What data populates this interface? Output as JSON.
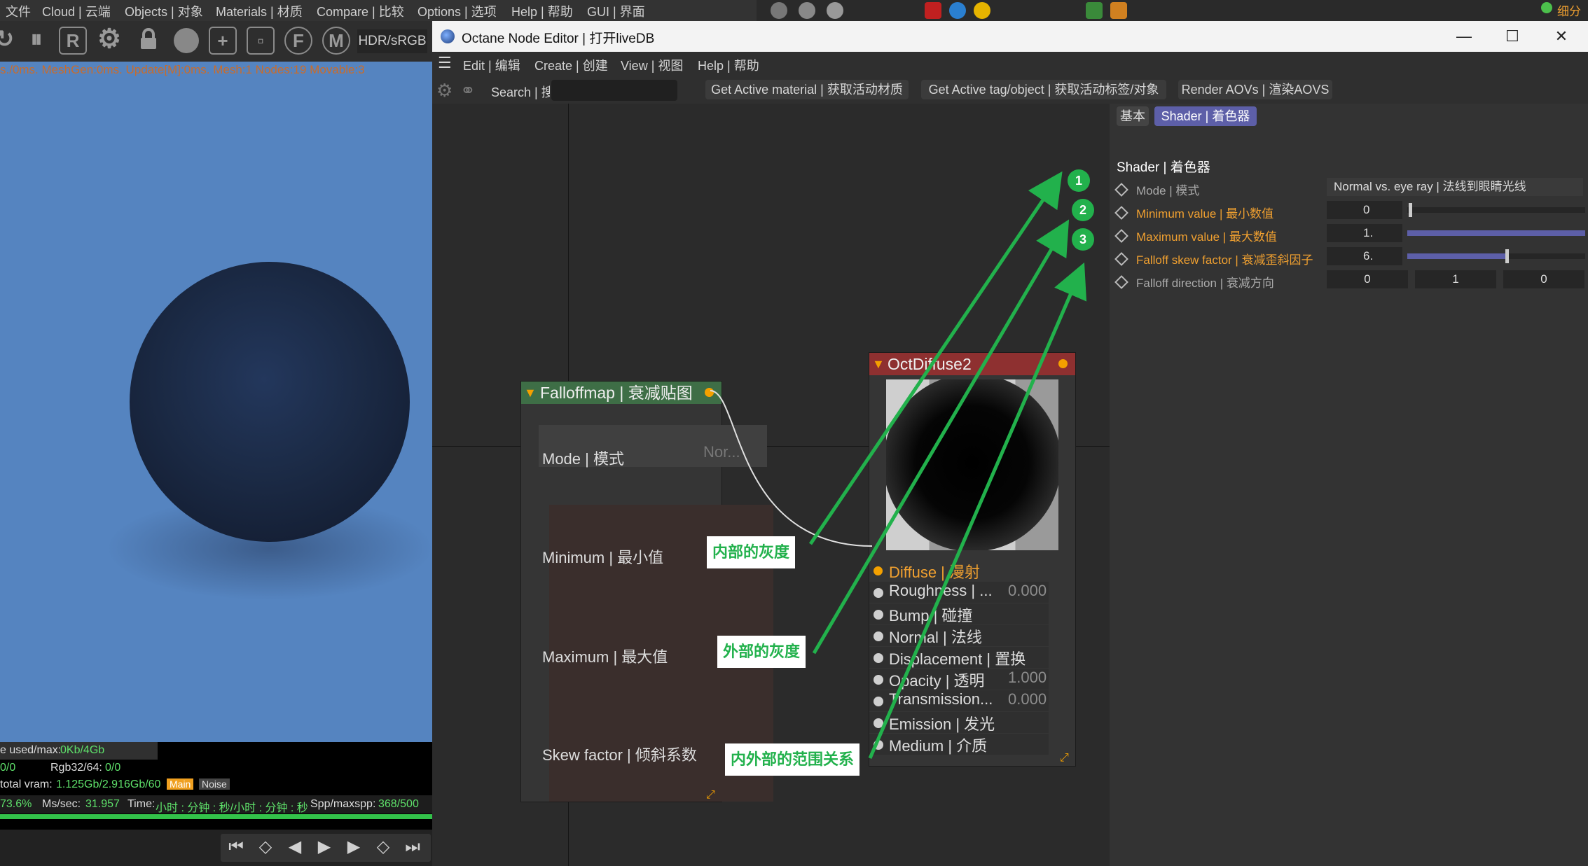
{
  "main_menu": [
    "文件",
    "Cloud | 云端",
    "Objects | 对象",
    "Materials | 材质",
    "Compare | 比较",
    "Options | 选项",
    "Help | 帮助",
    "GUI | 界面"
  ],
  "right_strip": {
    "object_name": "细分曲面"
  },
  "viewport": {
    "hdr_label": "HDR/sRGB",
    "stats": "s./0ms. MeshGen:0ms. Update[M]:0ms. Mesh:1 Nodes:19 Movable:3",
    "toolbar_icons": [
      "refresh-icon",
      "pause-icon",
      "region-render-icon",
      "settings-gear-icon",
      "lock-icon",
      "sphere-icon",
      "add-object-icon",
      "camera-icon",
      "focus-icon",
      "material-icon"
    ]
  },
  "status": {
    "used_max_label": "e used/max:",
    "used_max_value": "0Kb/4Gb",
    "left_value": "0/0",
    "rgb_label": "Rgb32/64:",
    "rgb_value": "0/0",
    "vram_label": "total vram:",
    "vram_value": "1.125Gb/2.916Gb/60",
    "tab_main": "Main",
    "tab_noise": "Noise",
    "percent": "73.6%",
    "ms_label": "Ms/sec:",
    "ms_value": "31.957",
    "time_label": "Time:",
    "time_value": "小时 : 分钟 : 秒/小时 : 分钟 : 秒",
    "spp_label": "Spp/maxspp:",
    "spp_value": "368/500",
    "progress": 0.736
  },
  "playback_buttons": [
    "go-start-icon",
    "prev-key-icon",
    "step-back-icon",
    "play-icon",
    "step-forward-icon",
    "next-key-icon",
    "go-end-icon"
  ],
  "node_window": {
    "title": "Octane Node Editor | 打开liveDB",
    "menu": [
      "Edit | 编辑",
      "Create | 创建",
      "View | 视图",
      "Help | 帮助"
    ],
    "search_label": "Search | 搜",
    "search_value": "",
    "toolbar_buttons": [
      "Get Active material | 获取活动材质",
      "Get Active tag/object | 获取活动标签/对象",
      "Render AOVs | 渲染AOVS"
    ]
  },
  "falloff_node": {
    "title": "Falloffmap | 衰减贴图",
    "mode_label": "Mode | 模式",
    "mode_value": "Nor...",
    "minimum_label": "Minimum | 最小值",
    "maximum_label": "Maximum | 最大值",
    "skew_label": "Skew factor | 倾斜系数"
  },
  "diffuse_node": {
    "title": "OctDiffuse2",
    "inputs": [
      {
        "label": "Diffuse | 漫射",
        "value": "",
        "active": true
      },
      {
        "label": "Roughness | ...",
        "value": "0.000"
      },
      {
        "label": "Bump | 碰撞",
        "value": ""
      },
      {
        "label": "Normal | 法线",
        "value": ""
      },
      {
        "label": "Displacement | 置换",
        "value": ""
      },
      {
        "label": "Opacity | 透明",
        "value": "1.000"
      },
      {
        "label": "Transmission...",
        "value": "0.000"
      },
      {
        "label": "Emission | 发光",
        "value": ""
      },
      {
        "label": "Medium | 介质",
        "value": ""
      }
    ]
  },
  "annotations": {
    "inner_gray": "内部的灰度",
    "outer_gray": "外部的灰度",
    "range_relation": "内外部的范围关系",
    "badges": [
      "1",
      "2",
      "3"
    ],
    "color": "#22b14c"
  },
  "properties": {
    "tab_basic": "基本",
    "tab_shader": "Shader | 着色器",
    "section_title": "Shader | 着色器",
    "mode_label": "Mode | 模式",
    "mode_value": "Normal vs. eye ray | 法线到眼睛光线",
    "min_label": "Minimum value | 最小数值",
    "min_value": "0",
    "min_fraction": 0.0,
    "max_label": "Maximum value | 最大数值",
    "max_value": "1.",
    "max_fraction": 1.0,
    "skew_label": "Falloff skew factor | 衰减歪斜因子",
    "skew_value": "6.",
    "skew_fraction": 0.55,
    "dir_label": "Falloff direction | 衰减方向",
    "dir_x": "0",
    "dir_y": "1",
    "dir_z": "0",
    "highlight_color": "#f0a030"
  }
}
